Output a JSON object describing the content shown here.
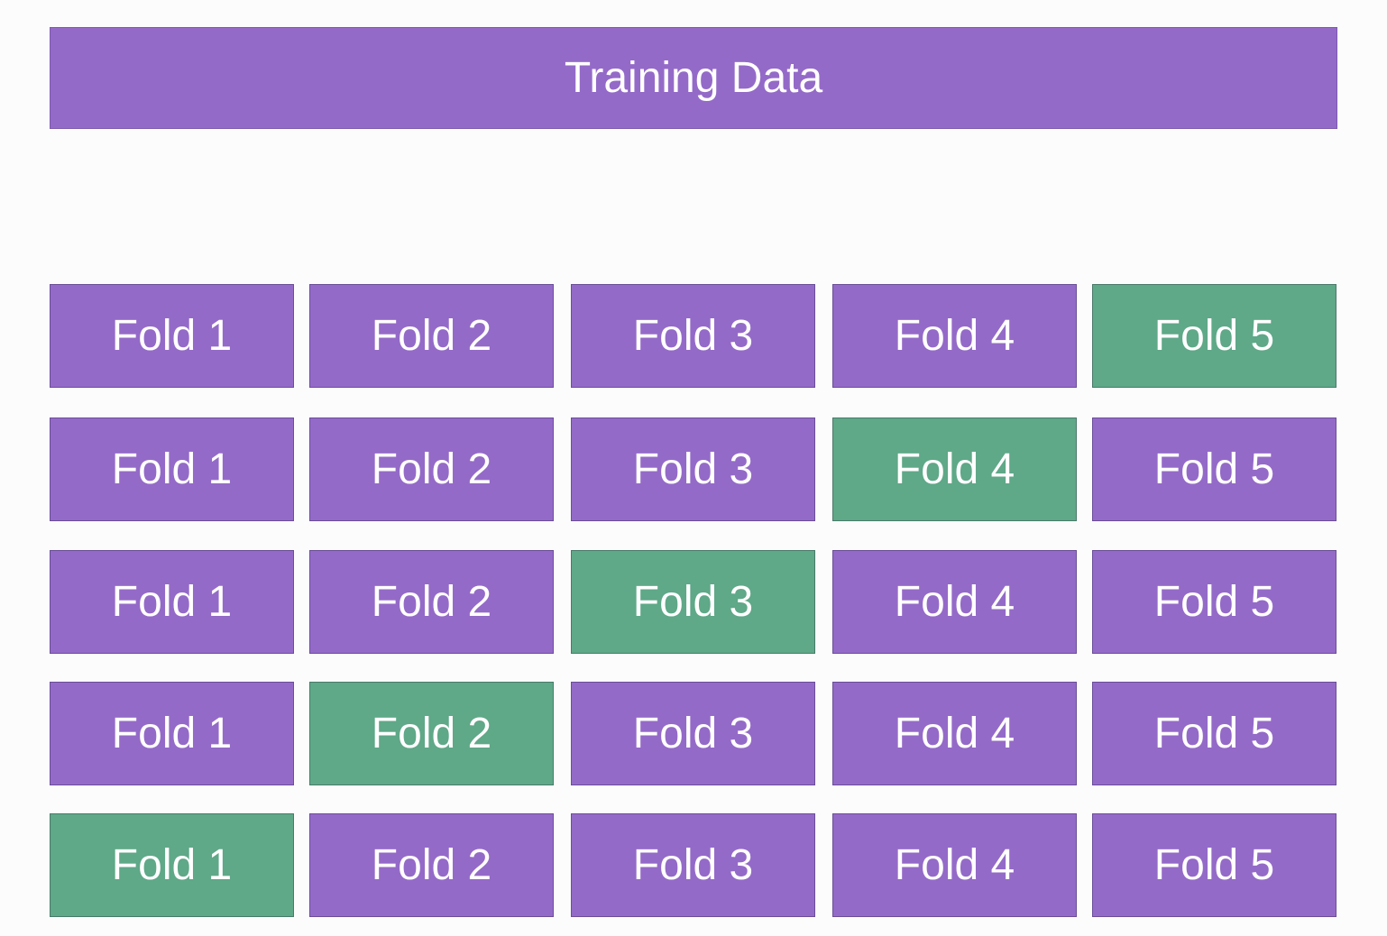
{
  "diagram": {
    "training_label": "Training Data",
    "colors": {
      "training": "#946ac8",
      "validation": "#5fa888",
      "background": "#fdfcfd"
    },
    "rows": [
      {
        "folds": [
          "Fold 1",
          "Fold 2",
          "Fold 3",
          "Fold 4",
          "Fold 5"
        ],
        "validation_fold": 5
      },
      {
        "folds": [
          "Fold 1",
          "Fold 2",
          "Fold 3",
          "Fold 4",
          "Fold 5"
        ],
        "validation_fold": 4
      },
      {
        "folds": [
          "Fold 1",
          "Fold 2",
          "Fold 3",
          "Fold 4",
          "Fold 5"
        ],
        "validation_fold": 3
      },
      {
        "folds": [
          "Fold 1",
          "Fold 2",
          "Fold 3",
          "Fold 4",
          "Fold 5"
        ],
        "validation_fold": 2
      },
      {
        "folds": [
          "Fold 1",
          "Fold 2",
          "Fold 3",
          "Fold 4",
          "Fold 5"
        ],
        "validation_fold": 1
      }
    ]
  }
}
